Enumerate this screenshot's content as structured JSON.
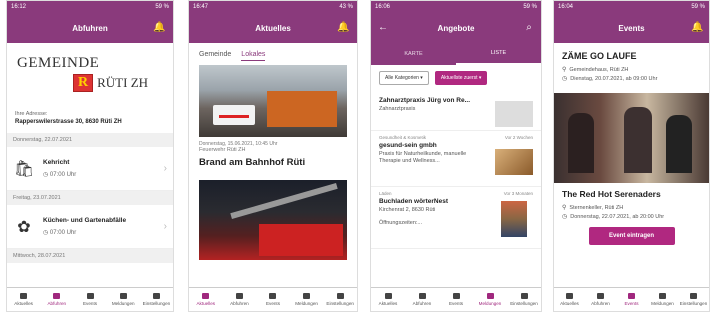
{
  "nav": [
    "Aktuelles",
    "Abfuhren",
    "Events",
    "Meldungen",
    "Einstellungen"
  ],
  "p1": {
    "time": "16:12",
    "status_right": "59 %",
    "title": "Abfuhren",
    "logo_word": "GEMEINDE",
    "logo_place": "RÜTI ZH",
    "logo_letter": "R",
    "address_label": "Ihre Adresse:",
    "address": "Rapperswilerstrasse 30, 8630 Rüti ZH",
    "sections": [
      {
        "date": "Donnerstag, 22.07.2021",
        "title": "Kehricht",
        "time": "07:00 Uhr"
      },
      {
        "date": "Freitag, 23.07.2021",
        "title": "Küchen- und Gartenabfälle",
        "time": "07:00 Uhr"
      }
    ],
    "last_date": "Mittwoch, 28.07.2021"
  },
  "p2": {
    "time": "16:47",
    "status_right": "43 %",
    "title": "Aktuelles",
    "tab1": "Gemeinde",
    "tab2": "Lokales",
    "meta1": "Donnerstag, 15.06.2021, 10:45 Uhr",
    "meta2": "Feuerwehr Rüti ZH",
    "headline": "Brand am Bahnhof Rüti"
  },
  "p3": {
    "time": "16:06",
    "status_right": "59 %",
    "title": "Angebote",
    "seg1": "KARTE",
    "seg2": "LISTE",
    "chip1": "Alle Kategorien ▾",
    "chip2": "Aktuellste zuerst ▾",
    "cards": [
      {
        "cat": "",
        "ago": "",
        "title": "Zahnarztpraxis Jürg von Re...",
        "sub": "Zahnarztpraxis"
      },
      {
        "cat": "Gesundheit & Kosmetik",
        "ago": "Vor 2 Wochen",
        "title": "gesund-sein gmbh",
        "sub": "Praxis für Naturheilkunde, manuelle Therapie und Wellness..."
      },
      {
        "cat": "Läden",
        "ago": "Vor 3 Monaten",
        "title": "Buchladen wörterNest",
        "sub": "Kirchenrat 2, 8630 Rüti"
      }
    ],
    "hours": "Öffnungszeiten:..."
  },
  "p4": {
    "time": "16:04",
    "status_right": "59 %",
    "title": "Events",
    "ev1_title": "ZÄME GO LAUFE",
    "ev1_loc": "Gemeindehaus, Rüti ZH",
    "ev1_date": "Dienstag, 20.07.2021, ab 09:00 Uhr",
    "ev2_title": "The Red Hot Serenaders",
    "ev2_loc": "Sternenkeller, Rüti ZH",
    "ev2_date": "Donnerstag, 22.07.2021, ab 20:00 Uhr",
    "button": "Event eintragen"
  }
}
